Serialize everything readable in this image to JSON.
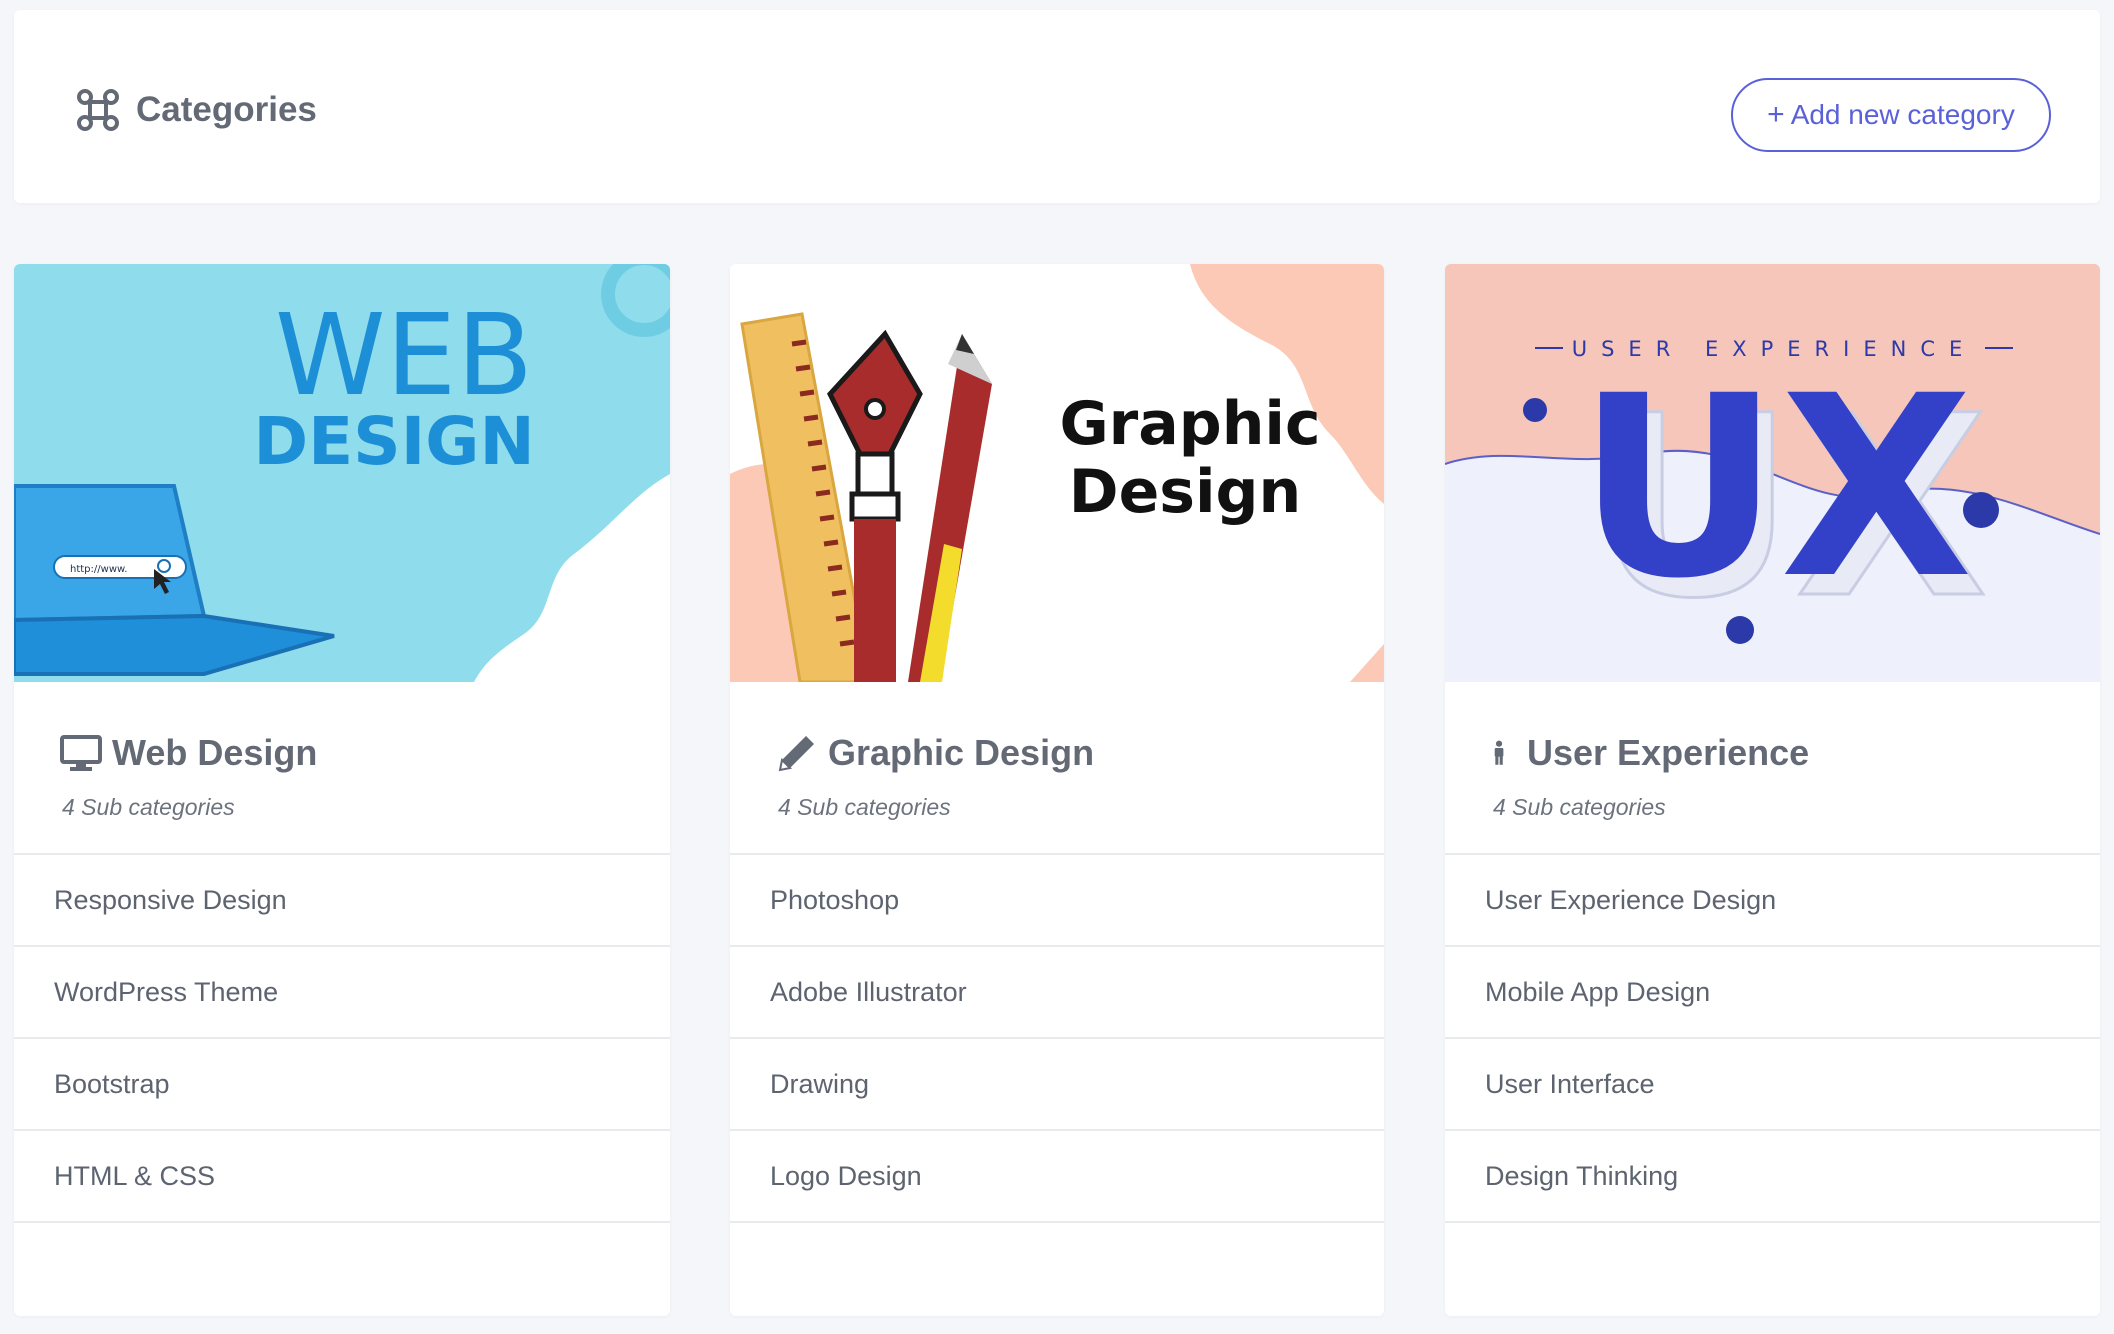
{
  "header": {
    "title": "Categories",
    "icon": "command-icon",
    "add_button_plus": "+",
    "add_button_label": "Add new category",
    "accent_color": "#5a60d8"
  },
  "cards": [
    {
      "image_text": {
        "line1": "WEB",
        "line2": "DESIGN",
        "bar_text": "http://www."
      },
      "icon": "monitor-icon",
      "title": "Web Design",
      "subtitle": "4 Sub categories",
      "items": [
        "Responsive Design",
        "WordPress Theme",
        "Bootstrap",
        "HTML & CSS"
      ]
    },
    {
      "image_text": {
        "line1": "Graphic",
        "line2": "Design"
      },
      "icon": "pencil-icon",
      "title": "Graphic Design",
      "subtitle": "4 Sub categories",
      "items": [
        "Photoshop",
        "Adobe Illustrator",
        "Drawing",
        "Logo Design"
      ]
    },
    {
      "image_text": {
        "top": "USER EXPERIENCE",
        "big": "UX"
      },
      "icon": "person-icon",
      "title": "User Experience",
      "subtitle": "4 Sub categories",
      "items": [
        "User Experience Design",
        "Mobile App Design",
        "User Interface",
        "Design Thinking"
      ]
    }
  ]
}
